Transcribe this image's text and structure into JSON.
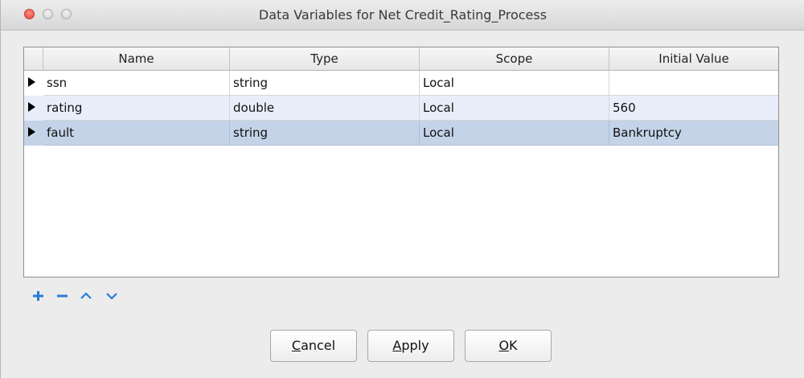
{
  "window": {
    "title": "Data Variables for Net Credit_Rating_Process"
  },
  "table": {
    "columns": [
      "Name",
      "Type",
      "Scope",
      "Initial Value"
    ],
    "rows": [
      {
        "name": "ssn",
        "type": "string",
        "scope": "Local",
        "initial_value": ""
      },
      {
        "name": "rating",
        "type": "double",
        "scope": "Local",
        "initial_value": "560"
      },
      {
        "name": "fault",
        "type": "string",
        "scope": "Local",
        "initial_value": "Bankruptcy"
      }
    ],
    "selected_row": 2
  },
  "toolbar": {
    "icons": [
      "add-icon",
      "remove-icon",
      "move-up-icon",
      "move-down-icon"
    ],
    "accent": "#2a7bd5"
  },
  "buttons": {
    "cancel": {
      "mnemonic": "C",
      "rest": "ancel"
    },
    "apply": {
      "mnemonic": "A",
      "rest": "pply"
    },
    "ok": {
      "mnemonic": "O",
      "rest": "K"
    }
  }
}
